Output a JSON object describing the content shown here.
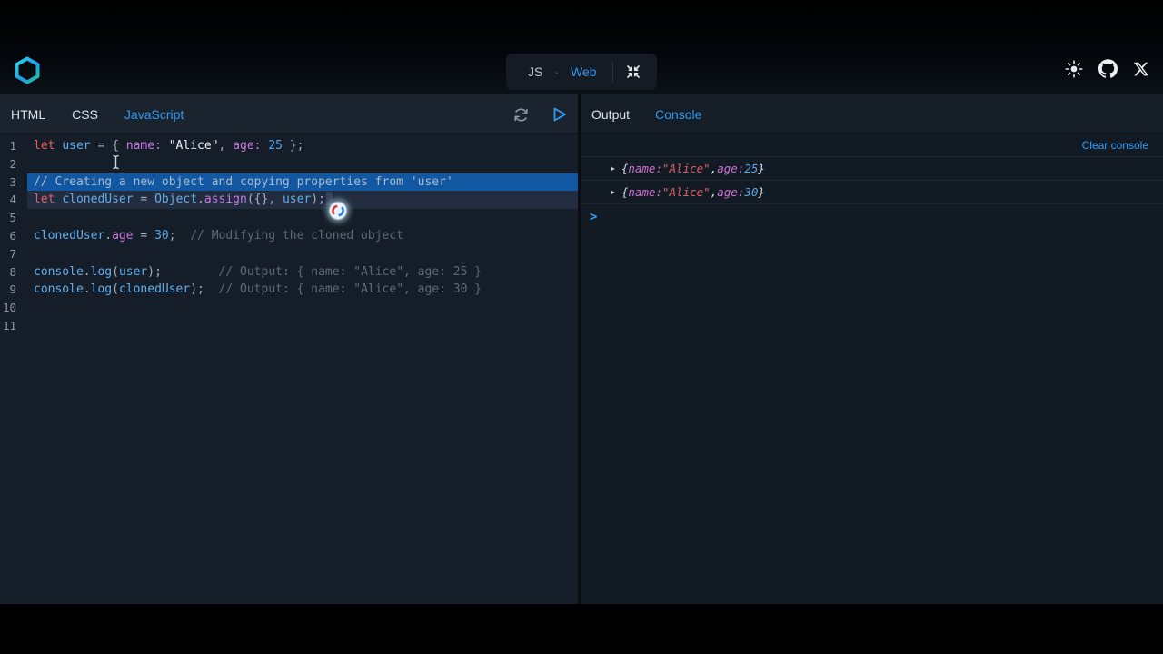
{
  "topbar": {
    "mode": {
      "js": "JS",
      "dot": "·",
      "web": "Web"
    },
    "icons": [
      "theme-sun-icon",
      "github-icon",
      "x-logo-icon"
    ]
  },
  "colors": {
    "accent_blue": "#3396ef",
    "selection_blue": "#1257a2",
    "current_line": "#212d3f",
    "editor_bg": "#151e28",
    "console_bg": "#121a23",
    "keyword_red": "#ee5d64",
    "variable_blue": "#61aeee",
    "property_purple": "#c678dd",
    "console_string_red": "#e4606a"
  },
  "left": {
    "tabs": [
      {
        "label": "HTML",
        "active": false
      },
      {
        "label": "CSS",
        "active": false
      },
      {
        "label": "JavaScript",
        "active": true
      }
    ]
  },
  "editor": {
    "lines": [
      {
        "n": "1",
        "state": "",
        "tokens": [
          [
            "kw",
            "let"
          ],
          [
            "pn",
            " "
          ],
          [
            "vr",
            "user"
          ],
          [
            "pn",
            " = { "
          ],
          [
            "pr",
            "name:"
          ],
          [
            "pn",
            " "
          ],
          [
            "st",
            "\"Alice\""
          ],
          [
            "pn",
            ", "
          ],
          [
            "pr",
            "age:"
          ],
          [
            "pn",
            " "
          ],
          [
            "nm",
            "25"
          ],
          [
            "pn",
            " };"
          ]
        ]
      },
      {
        "n": "2",
        "state": "",
        "tokens": []
      },
      {
        "n": "3",
        "state": "sel",
        "tokens": [
          [
            "cms",
            "// Creating a new object and copying properties from 'user'"
          ]
        ]
      },
      {
        "n": "4",
        "state": "cur",
        "cursor": true,
        "tokens": [
          [
            "kw",
            "let"
          ],
          [
            "pn",
            " "
          ],
          [
            "vr",
            "clonedUser"
          ],
          [
            "pn",
            " = "
          ],
          [
            "vr",
            "Object"
          ],
          [
            "pn",
            "."
          ],
          [
            "pr",
            "assign"
          ],
          [
            "pn",
            "({}, "
          ],
          [
            "vr",
            "user"
          ],
          [
            "pn",
            ");"
          ]
        ]
      },
      {
        "n": "5",
        "state": "",
        "tokens": []
      },
      {
        "n": "6",
        "state": "",
        "tokens": [
          [
            "vr",
            "clonedUser"
          ],
          [
            "pn",
            "."
          ],
          [
            "pr",
            "age"
          ],
          [
            "pn",
            " = "
          ],
          [
            "nm",
            "30"
          ],
          [
            "pn",
            ";  "
          ],
          [
            "cm",
            "// Modifying the cloned object"
          ]
        ]
      },
      {
        "n": "7",
        "state": "",
        "tokens": []
      },
      {
        "n": "8",
        "state": "",
        "tokens": [
          [
            "vr",
            "console"
          ],
          [
            "pn",
            "."
          ],
          [
            "vr",
            "log"
          ],
          [
            "pn",
            "("
          ],
          [
            "vr",
            "user"
          ],
          [
            "pn",
            ");        "
          ],
          [
            "cm",
            "// Output: { name: \"Alice\", age: 25 }"
          ]
        ]
      },
      {
        "n": "9",
        "state": "",
        "tokens": [
          [
            "vr",
            "console"
          ],
          [
            "pn",
            "."
          ],
          [
            "vr",
            "log"
          ],
          [
            "pn",
            "("
          ],
          [
            "vr",
            "clonedUser"
          ],
          [
            "pn",
            ");  "
          ],
          [
            "cm",
            "// Output: { name: \"Alice\", age: 30 }"
          ]
        ]
      },
      {
        "n": "10",
        "state": "",
        "tokens": []
      },
      {
        "n": "11",
        "state": "",
        "tokens": []
      }
    ]
  },
  "right": {
    "tabs": [
      {
        "label": "Output",
        "active": false
      },
      {
        "label": "Console",
        "active": true
      }
    ],
    "clear_label": "Clear console",
    "expander": "▶",
    "prompt": ">",
    "entries": [
      {
        "tokens": [
          [
            "c-pn",
            "{"
          ],
          [
            "c-prop",
            "name:"
          ],
          [
            "c-pn",
            " "
          ],
          [
            "c-str",
            "\"Alice\""
          ],
          [
            "c-pn",
            ", "
          ],
          [
            "c-prop",
            "age:"
          ],
          [
            "c-pn",
            " "
          ],
          [
            "c-num",
            "25"
          ],
          [
            "c-pn",
            "}"
          ]
        ]
      },
      {
        "tokens": [
          [
            "c-pn",
            "{"
          ],
          [
            "c-prop",
            "name:"
          ],
          [
            "c-pn",
            " "
          ],
          [
            "c-str",
            "\"Alice\""
          ],
          [
            "c-pn",
            ", "
          ],
          [
            "c-prop",
            "age:"
          ],
          [
            "c-pn",
            " "
          ],
          [
            "c-num",
            "30"
          ],
          [
            "c-pn",
            "}"
          ]
        ]
      }
    ]
  }
}
